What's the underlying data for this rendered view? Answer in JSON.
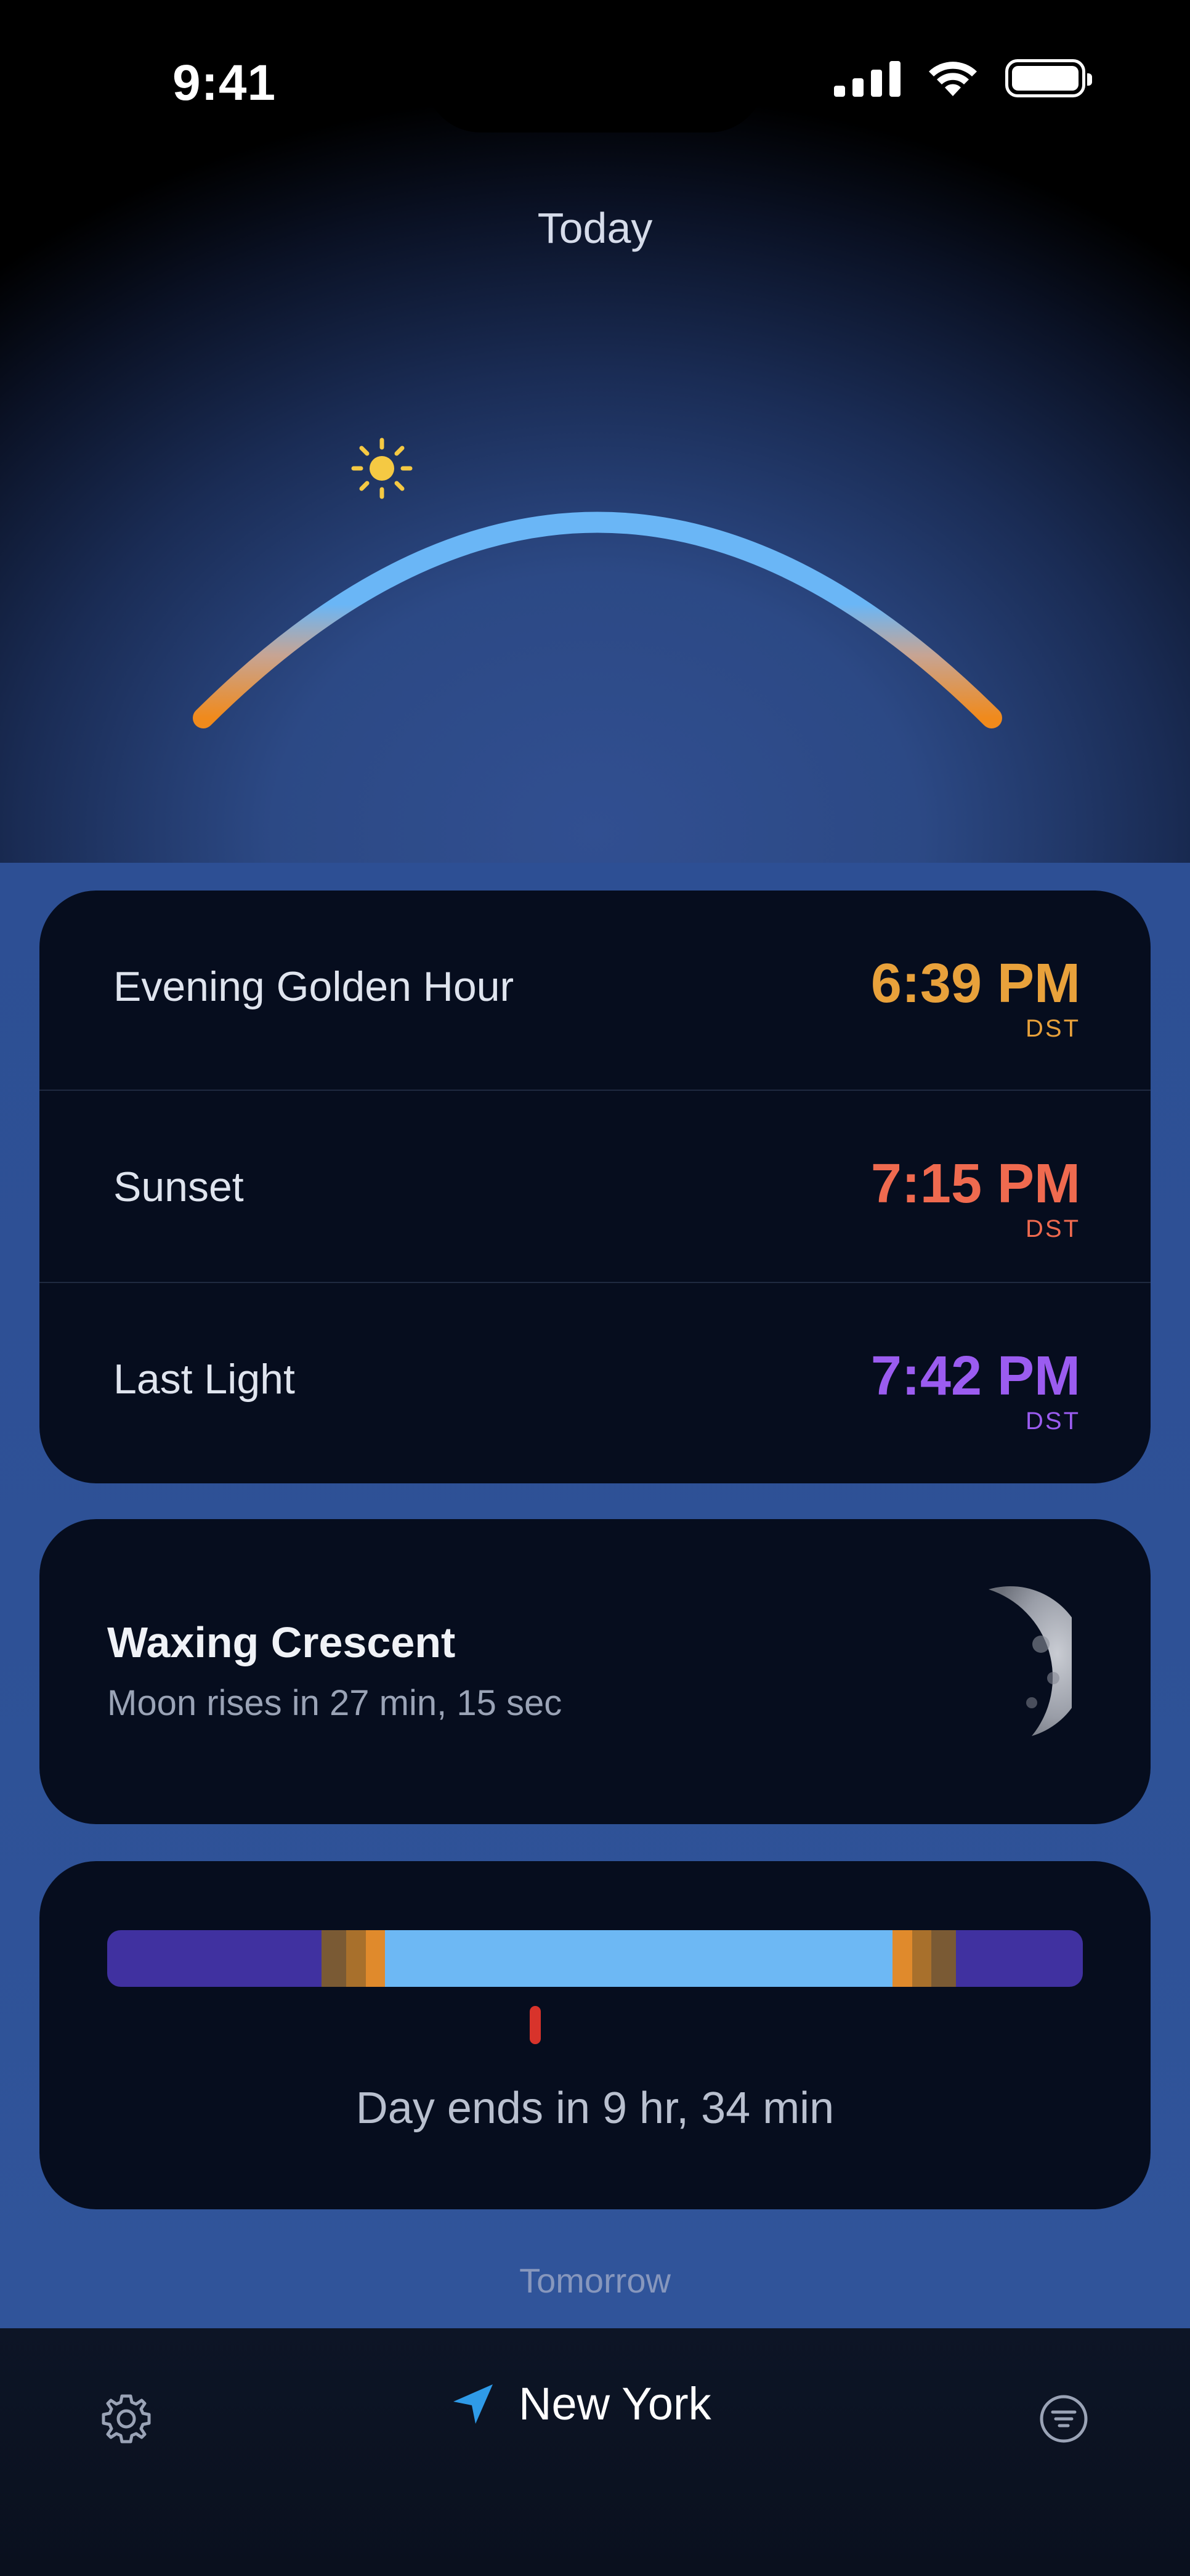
{
  "status_bar": {
    "time": "9:41"
  },
  "header": {
    "title": "Today"
  },
  "times": [
    {
      "label": "Evening Golden Hour",
      "value": "6:39 PM",
      "zone": "DST",
      "color": "#e8a13b"
    },
    {
      "label": "Sunset",
      "value": "7:15 PM",
      "zone": "DST",
      "color": "#ef6a4f"
    },
    {
      "label": "Last Light",
      "value": "7:42 PM",
      "zone": "DST",
      "color": "#9b5cf0"
    }
  ],
  "moon": {
    "phase": "Waxing Crescent",
    "rise_text": "Moon rises in 27 min, 15 sec"
  },
  "day": {
    "remaining_text": "Day ends in 9 hr, 34 min"
  },
  "footer_hint": "Tomorrow",
  "tab_bar": {
    "location": "New York",
    "left_icon": "gear-icon",
    "right_icon": "filter-icon"
  },
  "colors": {
    "night": "#4031a0",
    "golden": "#e08a2c",
    "day": "#6db8f4",
    "now_marker": "#d8332b",
    "sun": "#f5c943"
  }
}
